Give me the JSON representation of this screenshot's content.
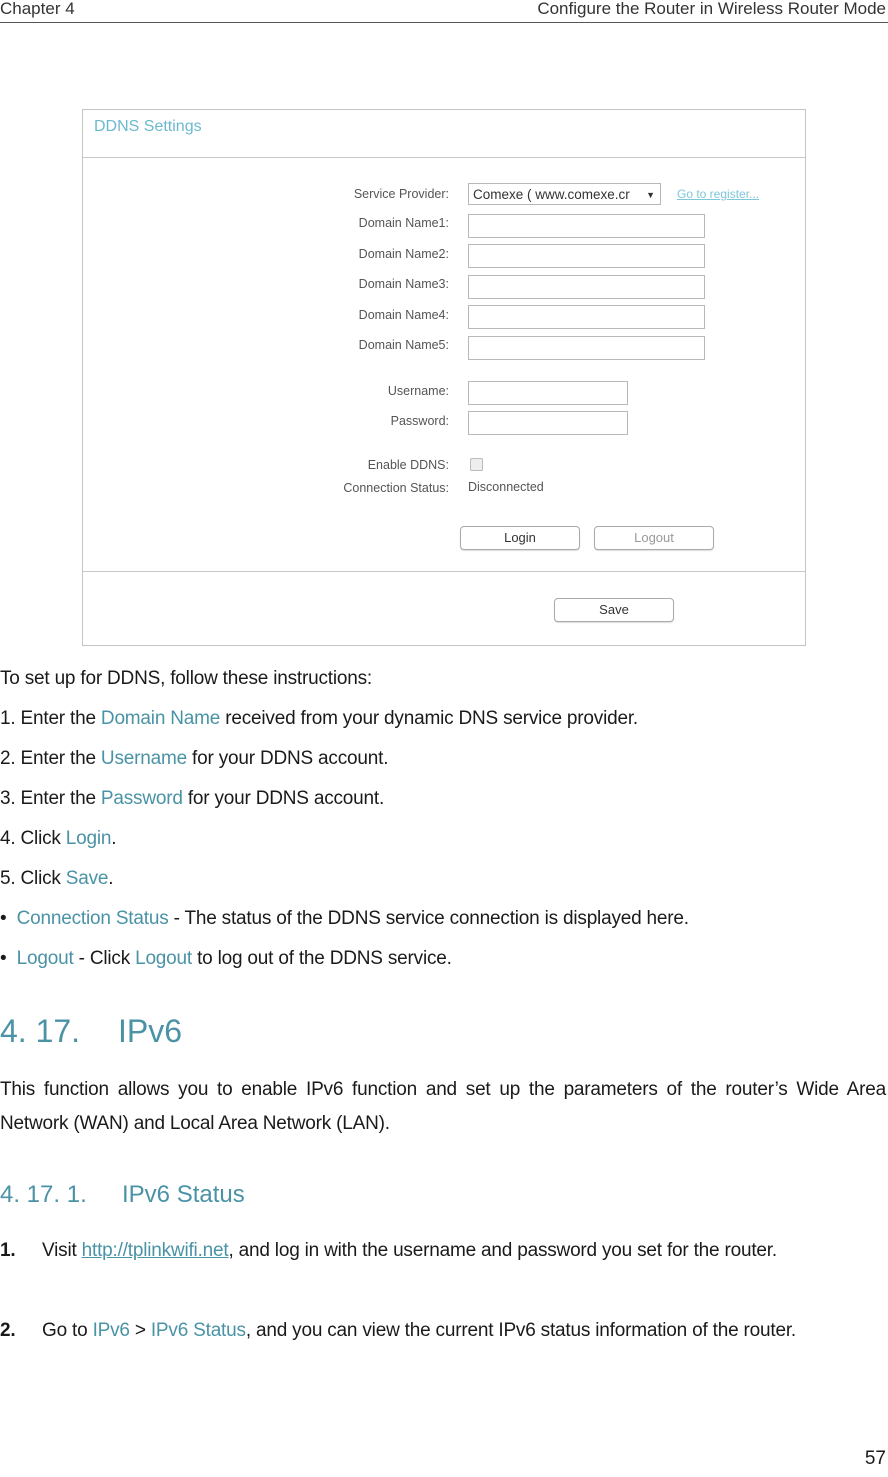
{
  "header": {
    "chapter": "Chapter 4",
    "section_title": "Configure the Router in Wireless Router Mode"
  },
  "screenshot": {
    "title": "DDNS Settings",
    "service_provider_label": "Service Provider:",
    "service_provider_value": "Comexe ( www.comexe.cr",
    "register_link": "Go to register...",
    "domain_labels": [
      "Domain Name1:",
      "Domain Name2:",
      "Domain Name3:",
      "Domain Name4:",
      "Domain Name5:"
    ],
    "domain_values": [
      "",
      "",
      "",
      "",
      ""
    ],
    "username_label": "Username:",
    "username_value": "",
    "password_label": "Password:",
    "password_value": "",
    "enable_ddns_label": "Enable DDNS:",
    "enable_ddns_checked": false,
    "connection_status_label": "Connection Status:",
    "connection_status_value": "Disconnected",
    "login_button": "Login",
    "logout_button": "Logout",
    "save_button": "Save"
  },
  "instructions": {
    "intro": "To set up for DDNS, follow these instructions:",
    "steps": [
      {
        "pre": "1. Enter the ",
        "hl": "Domain Name",
        "post": " received from your dynamic DNS service provider."
      },
      {
        "pre": "2. Enter the ",
        "hl": "Username",
        "post": " for your DDNS account."
      },
      {
        "pre": "3. Enter the ",
        "hl": "Password",
        "post": " for your DDNS account."
      },
      {
        "pre": "4. Click ",
        "hl": "Login",
        "post": "."
      },
      {
        "pre": "5. Click ",
        "hl": "Save",
        "post": "."
      }
    ],
    "bullets": [
      {
        "hl": "Connection Status",
        "post": " - The status of the DDNS service connection is displayed here."
      },
      {
        "hl": "Logout",
        "mid": " - Click ",
        "hl2": "Logout",
        "post": " to log out of the DDNS service."
      }
    ],
    "bullet_char": "•"
  },
  "section": {
    "number": "4. 17.",
    "title": "IPv6",
    "description": "This function allows you to enable IPv6 function and set up the parameters of the router’s Wide Area Network (WAN) and Local Area Network (LAN)."
  },
  "subsection": {
    "number": "4. 17. 1.",
    "title": "IPv6 Status",
    "steps": [
      {
        "num": "1.",
        "pre": "Visit ",
        "link": "http://tplinkwifi.net",
        "post": ", and log in with the username and password you set for the router."
      },
      {
        "num": "2.",
        "pre": "Go to ",
        "hl": "IPv6",
        "sep": " > ",
        "hl2": "IPv6 Status",
        "post": ", and you can view the current IPv6 status information of the router."
      }
    ]
  },
  "page_number": "57"
}
